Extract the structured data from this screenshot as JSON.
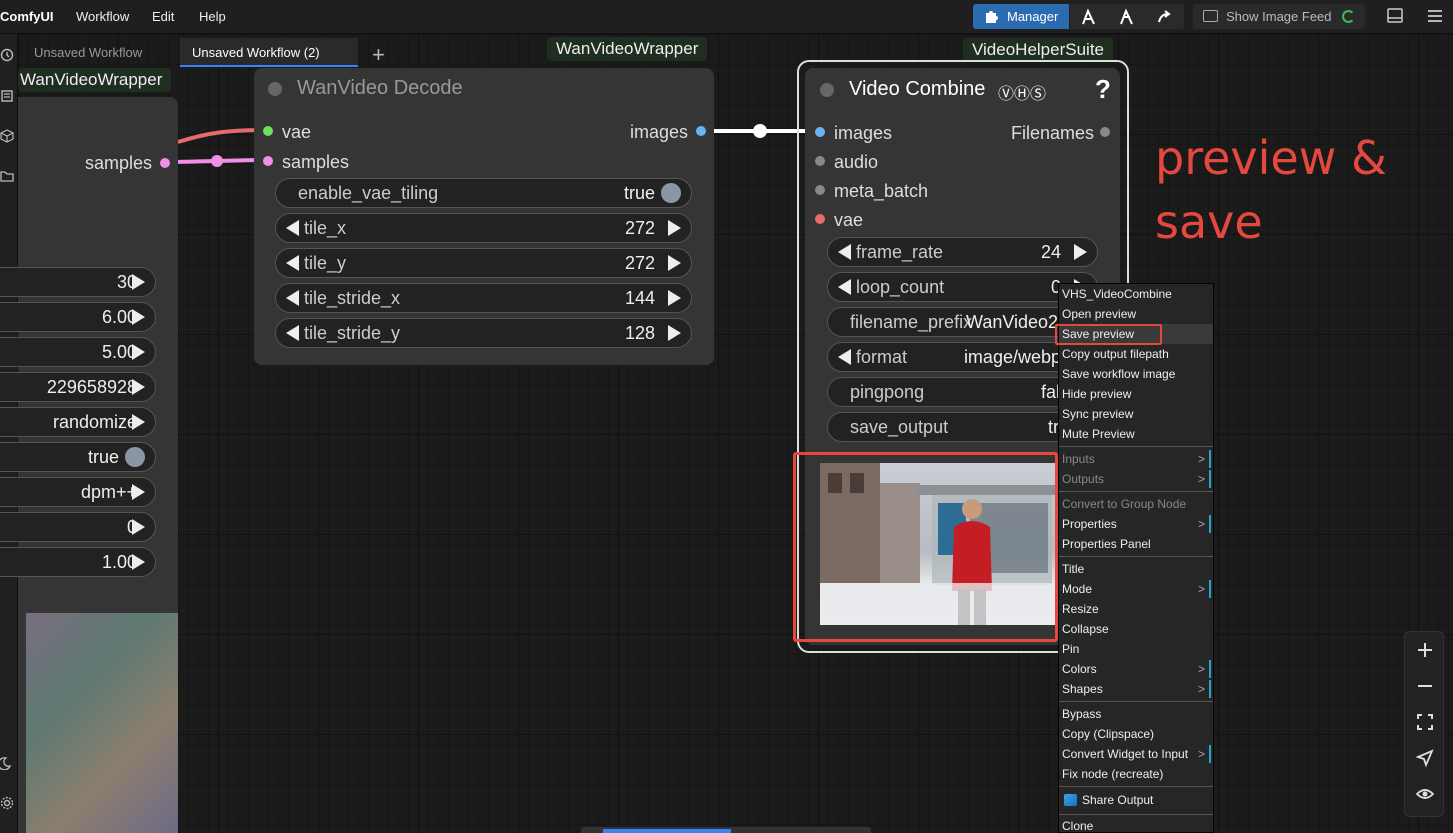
{
  "menubar": {
    "brand": "ComfyUI",
    "items": [
      "Workflow",
      "Edit",
      "Help"
    ],
    "manager_label": "Manager",
    "feed_label": "Show Image Feed"
  },
  "tabs": [
    {
      "label": "Unsaved Workflow",
      "active": false
    },
    {
      "label": "Unsaved Workflow (2)",
      "active": true
    }
  ],
  "groups": {
    "left_group": "WanVideoWrapper",
    "decode_group": "WanVideoWrapper",
    "vhs_group": "VideoHelperSuite"
  },
  "left_node": {
    "output_label": "samples",
    "widgets": [
      "30",
      "6.00",
      "5.00",
      "229658928",
      "randomize",
      "true",
      "dpm++",
      "0",
      "1.00"
    ]
  },
  "decode_node": {
    "title": "WanVideo Decode",
    "inputs": [
      "vae",
      "samples"
    ],
    "outputs": [
      "images"
    ],
    "widgets": [
      {
        "label": "enable_vae_tiling",
        "value": "true",
        "kind": "toggle"
      },
      {
        "label": "tile_x",
        "value": "272",
        "kind": "number"
      },
      {
        "label": "tile_y",
        "value": "272",
        "kind": "number"
      },
      {
        "label": "tile_stride_x",
        "value": "144",
        "kind": "number"
      },
      {
        "label": "tile_stride_y",
        "value": "128",
        "kind": "number"
      }
    ]
  },
  "combine_node": {
    "title": "Video Combine",
    "badge": "ⓋⒽⓈ",
    "help": "?",
    "inputs": [
      "images",
      "audio",
      "meta_batch",
      "vae"
    ],
    "outputs": [
      "Filenames"
    ],
    "widgets": [
      {
        "label": "frame_rate",
        "value": "24",
        "kind": "number"
      },
      {
        "label": "loop_count",
        "value": "0",
        "kind": "number"
      },
      {
        "label": "filename_prefix",
        "value": "WanVideo2",
        "kind": "text"
      },
      {
        "label": "format",
        "value": "image/webp",
        "kind": "combo"
      },
      {
        "label": "pingpong",
        "value": "false",
        "kind": "toggle"
      },
      {
        "label": "save_output",
        "value": "true",
        "kind": "toggle"
      }
    ]
  },
  "annotation": {
    "line1": "preview &",
    "line2": "save"
  },
  "context_menu": {
    "title": "VHS_VideoCombine",
    "items": [
      "Open preview",
      "Save preview",
      "Copy output filepath",
      "Save workflow image",
      "Hide preview",
      "Sync preview",
      "Mute Preview",
      "Inputs",
      "Outputs",
      "Convert to Group Node",
      "Properties",
      "Properties Panel",
      "Title",
      "Mode",
      "Resize",
      "Collapse",
      "Pin",
      "Colors",
      "Shapes",
      "Bypass",
      "Copy (Clipspace)",
      "Convert Widget to Input",
      "Fix node (recreate)",
      "Share Output",
      "Clone"
    ],
    "highlighted": "Save preview",
    "submenu_marker": ">"
  },
  "colors": {
    "accent": "#2b6cb0",
    "highlight_border": "#e5483f",
    "vae_slot": "#6be05c",
    "samples_slot": "#f08ee8",
    "images_slot": "#64b5f6"
  }
}
